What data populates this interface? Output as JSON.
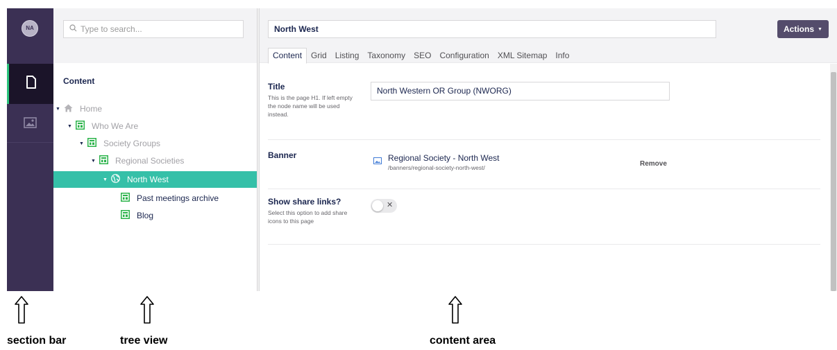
{
  "section_bar": {
    "avatar_initials": "NA",
    "items": [
      {
        "icon": "document-icon",
        "active": true
      },
      {
        "icon": "image-icon",
        "active": false
      }
    ]
  },
  "tree": {
    "search_placeholder": "Type to search...",
    "heading": "Content",
    "nodes": [
      {
        "label": "Home",
        "icon": "home-icon"
      },
      {
        "label": "Who We Are",
        "icon": "document-grid-icon"
      },
      {
        "label": "Society Groups",
        "icon": "document-grid-icon"
      },
      {
        "label": "Regional Societies",
        "icon": "document-grid-icon"
      },
      {
        "label": "North West",
        "icon": "globe-icon",
        "selected": true
      },
      {
        "label": "Past meetings archive",
        "icon": "document-grid-icon"
      },
      {
        "label": "Blog",
        "icon": "document-grid-icon"
      }
    ]
  },
  "content": {
    "node_name": "North West",
    "actions_label": "Actions",
    "tabs": [
      "Content",
      "Grid",
      "Listing",
      "Taxonomy",
      "SEO",
      "Configuration",
      "XML Sitemap",
      "Info"
    ],
    "properties": {
      "title": {
        "label": "Title",
        "description": "This is the page H1. If left empty the node name will be used instead.",
        "value": "North Western OR Group (NWORG)"
      },
      "banner": {
        "label": "Banner",
        "item_name": "Regional Society - North West",
        "item_path": "/banners/regional-society-north-west/",
        "remove_label": "Remove"
      },
      "share": {
        "label": "Show share links?",
        "description": "Select this option to add share icons to this page",
        "enabled": false
      }
    }
  },
  "annotations": {
    "section_bar": "section bar",
    "tree_view": "tree view",
    "content_area": "content area"
  },
  "colors": {
    "section_bar_bg": "#3b3054",
    "selected_node": "#35c0a8",
    "actions_button": "#544c6b",
    "active_indicator": "#2bc37c",
    "doc_icon_green": "#2bb34a"
  }
}
